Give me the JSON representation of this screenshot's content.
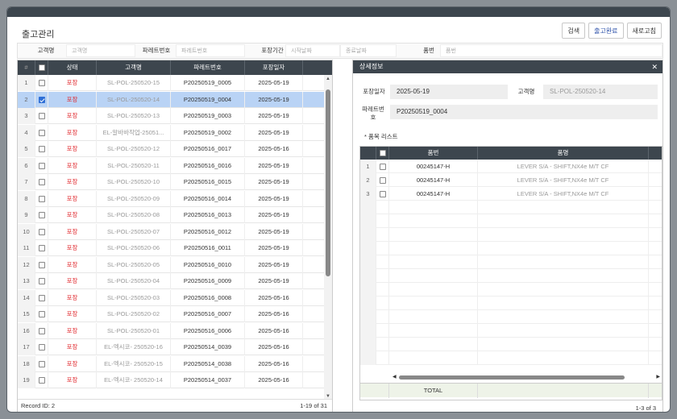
{
  "page_title": "출고관리",
  "actions": {
    "search": "검색",
    "complete": "출고완료",
    "refresh": "새로고침"
  },
  "search": {
    "customer_label": "고객명",
    "customer_placeholder": "고객명",
    "pallet_label": "파레트번호",
    "pallet_placeholder": "파레트번호",
    "period_label": "포장기간",
    "start_placeholder": "시작날짜",
    "end_placeholder": "종료날짜",
    "part_label": "품번",
    "part_placeholder": "품번"
  },
  "left_grid": {
    "columns": [
      "#",
      "상태",
      "고객명",
      "파레트번호",
      "포장일자"
    ],
    "rows": [
      {
        "n": "1",
        "checked": false,
        "status": "포장",
        "customer": "SL-POL-250520-15",
        "pallet": "P20250519_0005",
        "date": "2025-05-19"
      },
      {
        "n": "2",
        "checked": true,
        "status": "포장",
        "customer": "SL-POL-250520-14",
        "pallet": "P20250519_0004",
        "date": "2025-05-19"
      },
      {
        "n": "3",
        "checked": false,
        "status": "포장",
        "customer": "SL-POL-250520-13",
        "pallet": "P20250519_0003",
        "date": "2025-05-19"
      },
      {
        "n": "4",
        "checked": false,
        "status": "포장",
        "customer": "EL-알바바작업-25051...",
        "pallet": "P20250519_0002",
        "date": "2025-05-19"
      },
      {
        "n": "5",
        "checked": false,
        "status": "포장",
        "customer": "SL-POL-250520-12",
        "pallet": "P20250516_0017",
        "date": "2025-05-16"
      },
      {
        "n": "6",
        "checked": false,
        "status": "포장",
        "customer": "SL-POL-250520-11",
        "pallet": "P20250516_0016",
        "date": "2025-05-19"
      },
      {
        "n": "7",
        "checked": false,
        "status": "포장",
        "customer": "SL-POL-250520-10",
        "pallet": "P20250516_0015",
        "date": "2025-05-19"
      },
      {
        "n": "8",
        "checked": false,
        "status": "포장",
        "customer": "SL-POL-250520-09",
        "pallet": "P20250516_0014",
        "date": "2025-05-19"
      },
      {
        "n": "9",
        "checked": false,
        "status": "포장",
        "customer": "SL-POL-250520-08",
        "pallet": "P20250516_0013",
        "date": "2025-05-19"
      },
      {
        "n": "10",
        "checked": false,
        "status": "포장",
        "customer": "SL-POL-250520-07",
        "pallet": "P20250516_0012",
        "date": "2025-05-19"
      },
      {
        "n": "11",
        "checked": false,
        "status": "포장",
        "customer": "SL-POL-250520-06",
        "pallet": "P20250516_0011",
        "date": "2025-05-19"
      },
      {
        "n": "12",
        "checked": false,
        "status": "포장",
        "customer": "SL-POL-250520-05",
        "pallet": "P20250516_0010",
        "date": "2025-05-19"
      },
      {
        "n": "13",
        "checked": false,
        "status": "포장",
        "customer": "SL-POL-250520-04",
        "pallet": "P20250516_0009",
        "date": "2025-05-19"
      },
      {
        "n": "14",
        "checked": false,
        "status": "포장",
        "customer": "SL-POL-250520-03",
        "pallet": "P20250516_0008",
        "date": "2025-05-16"
      },
      {
        "n": "15",
        "checked": false,
        "status": "포장",
        "customer": "SL-POL-250520-02",
        "pallet": "P20250516_0007",
        "date": "2025-05-16"
      },
      {
        "n": "16",
        "checked": false,
        "status": "포장",
        "customer": "SL-POL-250520-01",
        "pallet": "P20250516_0006",
        "date": "2025-05-16"
      },
      {
        "n": "17",
        "checked": false,
        "status": "포장",
        "customer": "EL-엑시코- 250520-16",
        "pallet": "P20250514_0039",
        "date": "2025-05-16"
      },
      {
        "n": "18",
        "checked": false,
        "status": "포장",
        "customer": "EL-엑시코- 250520-15",
        "pallet": "P20250514_0038",
        "date": "2025-05-16"
      },
      {
        "n": "19",
        "checked": false,
        "status": "포장",
        "customer": "EL-엑시코- 250520-14",
        "pallet": "P20250514_0037",
        "date": "2025-05-16"
      }
    ],
    "record_id": "Record ID: 2",
    "range": "1-19 of 31"
  },
  "detail": {
    "title": "상세정보",
    "close": "✕",
    "pack_date_label": "포장일자",
    "pack_date": "2025-05-19",
    "customer_label": "고객명",
    "customer": "SL-POL-250520-14",
    "pallet_label": "파레트번호",
    "pallet": "P20250519_0004",
    "items_title": "* 품목 리스트",
    "columns": [
      "품번",
      "품명"
    ],
    "rows": [
      {
        "n": "1",
        "part": "00245147-H",
        "name": "LEVER S/A - SHIFT,NX4e M/T CF"
      },
      {
        "n": "2",
        "part": "00245147-H",
        "name": "LEVER S/A - SHIFT,NX4e M/T CF"
      },
      {
        "n": "3",
        "part": "00245147-H",
        "name": "LEVER S/A - SHIFT,NX4e M/T CF"
      }
    ],
    "total_label": "TOTAL",
    "range": "1-3 of 3"
  }
}
